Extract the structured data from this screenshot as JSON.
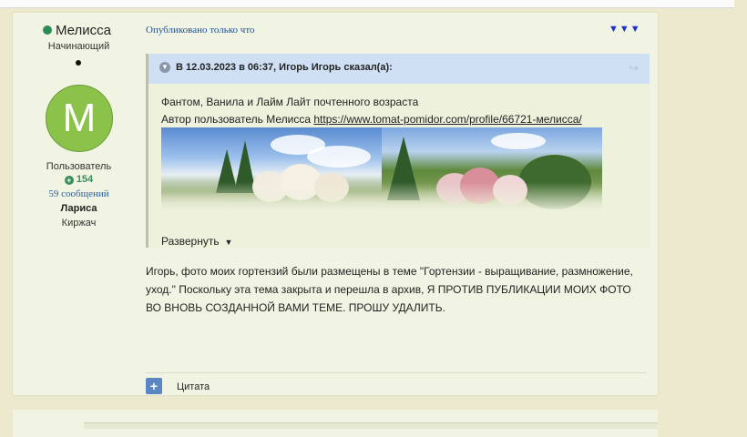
{
  "author": {
    "name": "Мелисса",
    "rank": "Начинающий",
    "avatar_letter": "М",
    "group": "Пользователь",
    "reputation": "154",
    "posts": "59 сообщений",
    "real_name": "Лариса",
    "city": "Киржач",
    "online_color": "#2e8b57",
    "avatar_color": "#8bc34a"
  },
  "post": {
    "published": "Опубликовано только что",
    "menu_icon": "▼▼▼",
    "quote": {
      "header": "В 12.03.2023 в 06:37, Игорь Игорь сказал(а):",
      "line1": "Фантом, Ванила и Лайм Лайт почтенного возраста",
      "line2_prefix": "Автор пользователь Мелисса ",
      "link": "https://www.tomat-pomidor.com/profile/66721-мелисса/",
      "expand": "Развернуть"
    },
    "body": "Игорь, фото моих гортензий были размещены в теме  \"Гортензии - выращивание, размножение, уход.\" Поскольку эта тема закрыта и  перешла в архив, Я ПРОТИВ ПУБЛИКАЦИИ МОИХ ФОТО ВО ВНОВЬ СОЗДАННОЙ ВАМИ ТЕМЕ. ПРОШУ УДАЛИТЬ.",
    "multiquote": "+",
    "quote_action": "Цитата"
  }
}
